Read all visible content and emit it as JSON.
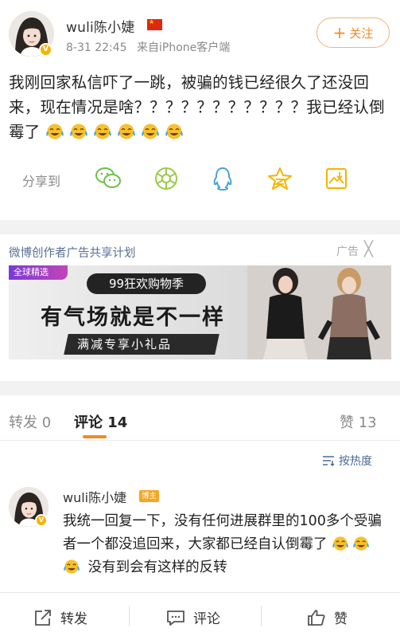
{
  "post": {
    "author": "wuli陈小婕",
    "time": "8-31 22:45",
    "source": "来自iPhone客户端",
    "follow_label": "关注",
    "follow_plus": "+",
    "text": "我刚回家私信吓了一跳，被骗的钱已经很久了还没回来，现在情况是啥？？？？？？？？？？？我已经认倒霉了",
    "emoji_name": "laughing-tears-emoji"
  },
  "share": {
    "label": "分享到",
    "icons": [
      "wechat-icon",
      "moments-icon",
      "qq-icon",
      "qzone-star-icon",
      "save-image-icon"
    ]
  },
  "ad": {
    "title": "微博创作者广告共享计划",
    "label": "广告",
    "close": "╳",
    "corner": "全球精选",
    "tag": "99狂欢购物季",
    "headline": "有气场就是不一样",
    "sub": "满减专享小礼品"
  },
  "tabs": {
    "repost": "转发 0",
    "comments": "评论 14",
    "likes": "赞 13"
  },
  "sort": {
    "label": "按热度"
  },
  "comment": {
    "author": "wuli陈小婕",
    "badge": "博主",
    "text_before": "我统一回复一下，没有任何进展群里的100多个受骗者一个都没追回来，大家都已经自认倒霉了",
    "text_after": "没有到会有这样的反转"
  },
  "bottom_bar": {
    "repost": "转发",
    "comment": "评论",
    "like": "赞"
  },
  "colors": {
    "accent": "#f28a24",
    "link": "#4a6a98",
    "icon_green": "#6cc04a",
    "icon_blue": "#45a3d8",
    "icon_yellow": "#f5b400"
  }
}
